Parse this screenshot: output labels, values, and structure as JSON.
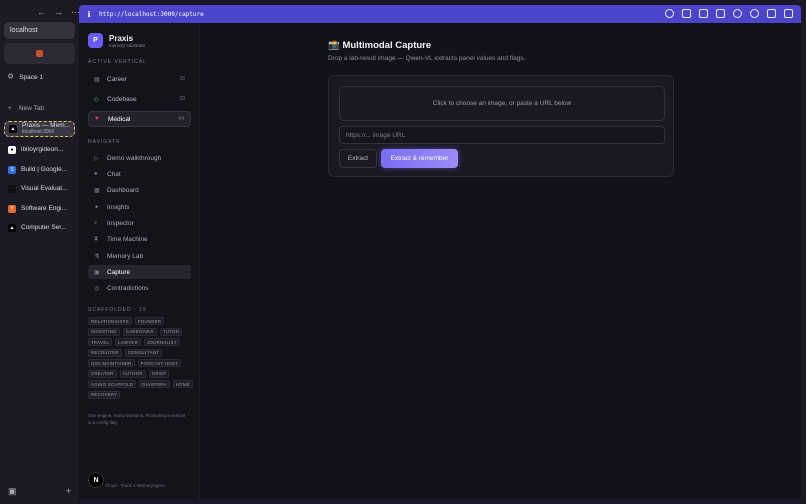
{
  "browser": {
    "url_bar": "localhost",
    "space": "Space 1",
    "new_tab": "New Tab",
    "tabs": [
      {
        "title": "Praxis — Mem...",
        "subtitle": "localhost:3000"
      },
      {
        "title": "ibitoyrgideon..."
      },
      {
        "title": "Build | Google..."
      },
      {
        "title": "Visual Evaluat..."
      },
      {
        "title": "Software Engi..."
      },
      {
        "title": "Computer Ser..."
      }
    ],
    "address": "http://localhost:3000/capture",
    "accent": "#4b46c9"
  },
  "sidebar": {
    "brand": {
      "letter": "P",
      "name": "Praxis",
      "tagline": "memory substrate"
    },
    "active_vertical_label": "ACTIVE VERTICAL",
    "verticals": [
      {
        "icon": "briefcase-icon",
        "label": "Career",
        "count": "16"
      },
      {
        "icon": "code-icon",
        "label": "Codebase",
        "count": "29"
      },
      {
        "icon": "heart-icon",
        "label": "Medical",
        "count": "64"
      }
    ],
    "navigate_label": "NAVIGATE",
    "nav": [
      {
        "icon": "play-icon",
        "label": "Demo walkthrough"
      },
      {
        "icon": "chat-icon",
        "label": "Chat"
      },
      {
        "icon": "grid-icon",
        "label": "Dashboard"
      },
      {
        "icon": "sparkle-icon",
        "label": "Insights"
      },
      {
        "icon": "search-icon",
        "label": "Inspector"
      },
      {
        "icon": "hourglass-icon",
        "label": "Time Machine"
      },
      {
        "icon": "flask-icon",
        "label": "Memory Lab"
      },
      {
        "icon": "camera-icon",
        "label": "Capture"
      },
      {
        "icon": "warning-icon",
        "label": "Contradictions"
      }
    ],
    "scaffolded_label": "SCAFFOLDED · 19",
    "scaffolded": [
      "RELATIONSHIPS",
      "FOUNDER",
      "INVESTING",
      "CAREGIVER",
      "TUTOR",
      "TRAVEL",
      "LAWYER",
      "JOURNALIST",
      "RECRUITER",
      "CONSULTANT",
      "OSS MAINTAINER",
      "PODCAST HOST",
      "CREATOR",
      "AUTHOR",
      "GRIEF",
      "AGING SCAFFOLD",
      "DIASPORA",
      "HOME",
      "RECOVERY"
    ],
    "note": "One engine, many domains. Promoting a vertical is a config flag.",
    "footer": "Cloud · Track 1 MemoryAgent"
  },
  "main": {
    "title": "📸 Multimodal Capture",
    "subtitle": "Drop a lab-result image — Qwen-VL extracts panel values and flags.",
    "drop_text": "Click to choose an image, or paste a URL below",
    "url_placeholder": "https://... image URL",
    "extract_label": "Extract",
    "extract_remember_label": "Extract & remember"
  }
}
